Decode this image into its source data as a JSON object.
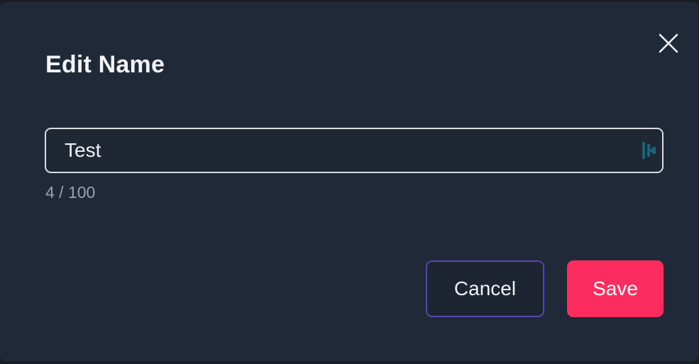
{
  "dialog": {
    "title": "Edit Name",
    "close_icon": "close-icon",
    "name_field": {
      "value": "Test",
      "placeholder": "",
      "extension_icon": "password-manager-icon"
    },
    "char_counter": "4 / 100",
    "cancel_label": "Cancel",
    "save_label": "Save"
  },
  "colors": {
    "dialog_bg": "#202938",
    "input_border": "#d9dde3",
    "cancel_border": "#5a45b0",
    "save_bg": "#fc2d5e",
    "counter_text": "#9aa2ad",
    "extension_icon": "#15667a"
  }
}
